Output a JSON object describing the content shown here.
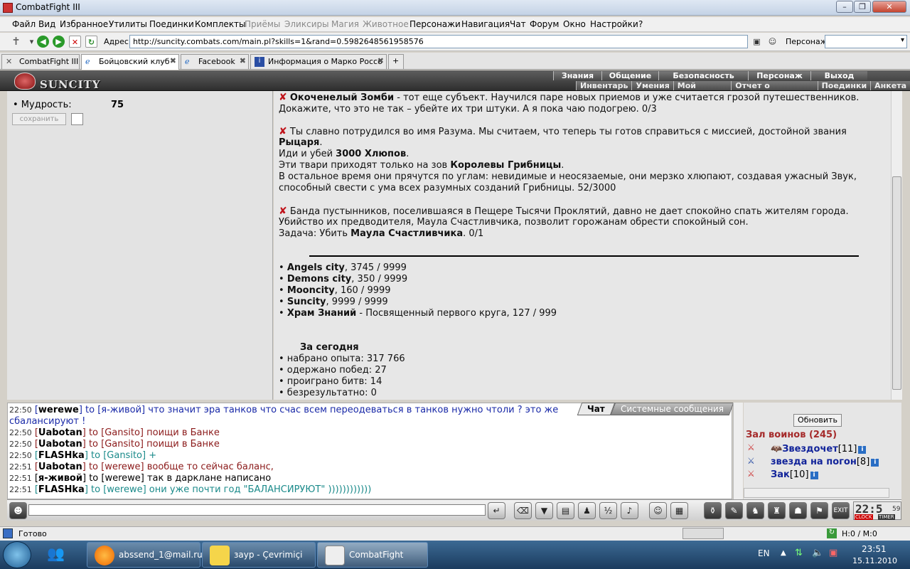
{
  "window": {
    "title": "CombatFight III"
  },
  "menu": [
    "Файл",
    "Вид",
    "Избранное",
    "Утилиты",
    "Поединки",
    "Комплекты",
    "Приёмы",
    "Эликсиры",
    "Магия",
    "Животное",
    "Персонажи",
    "Навигация",
    "Чат",
    "Форум",
    "Окно",
    "Настройки",
    "?"
  ],
  "addressbar": {
    "label": "Адрес:",
    "url": "http://suncity.combats.com/main.pl?skills=1&rand=0.5982648561958576",
    "persona_label": "Персонаж:"
  },
  "tabs": [
    {
      "label": "CombatFight III"
    },
    {
      "label": "Бойцовский клуб"
    },
    {
      "label": "Facebook"
    },
    {
      "label": "Информация о Марко Россо"
    }
  ],
  "game": {
    "logo": "SUNCITY",
    "nav": [
      "Знания",
      "Общение",
      "Безопасность",
      "Персонаж",
      "Выход"
    ],
    "subnav": [
      "Инвентарь",
      "Умения",
      "Мой Скролл",
      "Отчет о переводах",
      "Поединки",
      "Анкета"
    ]
  },
  "left": {
    "stat_label": "• Мудрость:",
    "stat_value": "75",
    "save_button": "сохранить"
  },
  "quests": {
    "q0": {
      "bold": "Окоченелый Зомби",
      "rest": " - тот еще субъект. Научился паре новых приемов и уже считается грозой путешественников."
    },
    "q0b": "Докажите, что это не так – убейте их три штуки. А я пока чаю подогрею. 0/3",
    "q1a": "Ты славно потрудился во имя Разума. Мы считаем, что теперь ты готов справиться с миссией, достойной звания",
    "q1b": "Рыцаря",
    "q1c_pre": "Иди и убей ",
    "q1c_b": "3000 Хлюпов",
    "q1d_pre": "Эти твари приходят только на зов ",
    "q1d_b": "Королевы Грибницы",
    "q1e": "В остальное время они прячутся по углам: невидимые и неосязаемые, они мерзко хлюпают, создавая ужасный Звук,",
    "q1f": "способный свести с ума всех разумных созданий Грибницы. 52/3000",
    "q2a": "Банда пустынников, поселившаяся в Пещере Тысячи Проклятий, давно не дает спокойно спать жителям города.",
    "q2b": "Убийство их предводителя, Маула Счастливчика, позволит горожанам обрести спокойный сон.",
    "q2c_pre": "Задача: Убить ",
    "q2c_b": "Маула Счастливчика",
    "q2c_post": ". 0/1"
  },
  "cities": [
    {
      "name": "Angels city",
      "value": ", 3745 / 9999"
    },
    {
      "name": "Demons city",
      "value": ", 350 / 9999"
    },
    {
      "name": "Mooncity",
      "value": ", 160 / 9999"
    },
    {
      "name": "Suncity",
      "value": ", 9999 / 9999"
    },
    {
      "name": "Храм Знаний",
      "value": " - Посвященный первого круга, 127 / 999"
    }
  ],
  "today": {
    "title": "За сегодня",
    "lines": [
      "• набрано опыта: 317 766",
      "• одержано побед: 27",
      "• проиграно битв: 14",
      "• безрезультатно: 0"
    ]
  },
  "chat": {
    "tabs": [
      "Чат",
      "Системные сообщения"
    ],
    "lines": [
      {
        "time": "22:50",
        "nick": "werewe",
        "text": " to [я-живой] что значит эра танков что счас всем переодеваться в танков нужно чтоли ? это же",
        "color": "#1a2aa8"
      },
      {
        "time": "",
        "nick": "",
        "text": "сбалансируют !",
        "color": "#1a2aa8"
      },
      {
        "time": "22:50",
        "nick": "Uabotan",
        "text": " to [Gansito] поищи в Банке",
        "color": "#8b1a1a"
      },
      {
        "time": "22:50",
        "nick": "Uabotan",
        "text": " to [Gansito] поищи в Банке",
        "color": "#8b1a1a"
      },
      {
        "time": "22:50",
        "nick": "FLASHka",
        "text": " to [Gansito] +",
        "color": "#1a8a8a"
      },
      {
        "time": "22:51",
        "nick": "Uabotan",
        "text": " to [werewe] вообще то сейчас баланс,",
        "color": "#8b1a1a"
      },
      {
        "time": "22:51",
        "nick": "я-живой",
        "text": " to [werewe] так в дарклане написано",
        "color": "#000000"
      },
      {
        "time": "22:51",
        "nick": "FLASHka",
        "text": " to [werewe] они уже почти год \"БАЛАНСИРУЮТ\" ))))))))))))",
        "color": "#1a8a8a"
      }
    ]
  },
  "warriors": {
    "refresh": "Обновить",
    "hall": "Зал воинов (245)",
    "list": [
      {
        "name": "Звездочет",
        "level": "[11]"
      },
      {
        "name": "звезда на погон",
        "level": "[8]"
      },
      {
        "name": "Зак",
        "level": "[10]"
      }
    ]
  },
  "clock": {
    "time": "22:5",
    "sec": "59",
    "clock_label": "CLOCK",
    "timer_label": "TIMER"
  },
  "status": {
    "text": "Готово",
    "counter": "H:0 / M:0"
  },
  "taskbar": {
    "items": [
      "abssend_1@mail.ru",
      "зayp - Çevrimiçi",
      "CombatFight"
    ],
    "lang": "EN",
    "time": "23:51",
    "date": "15.11.2010"
  }
}
